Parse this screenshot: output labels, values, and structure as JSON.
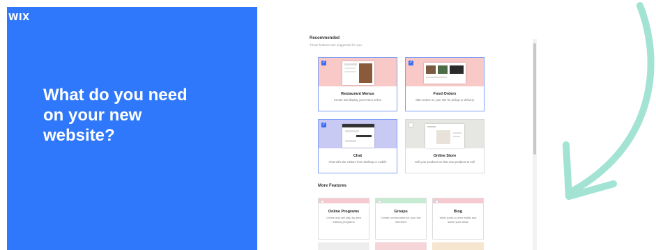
{
  "left": {
    "logo": "WIX",
    "headline": "What do you need on your new website?"
  },
  "recommended": {
    "title": "Recommended",
    "subtitle": "These features are suggested for you",
    "cards": [
      {
        "title": "Restaurant Menus",
        "desc": "Create and display your menu online",
        "selected": true,
        "color": "#f9c9c8"
      },
      {
        "title": "Food Orders",
        "desc": "Take orders on your site for pickup or delivery",
        "selected": true,
        "color": "#f9c9c8"
      },
      {
        "title": "Chat",
        "desc": "Chat with site visitors from desktop or mobile",
        "selected": true,
        "color": "#c9caf4"
      },
      {
        "title": "Online Store",
        "desc": "Sell your products on that new products to sell",
        "selected": false,
        "color": "#e6e6e2"
      }
    ]
  },
  "more": {
    "title": "More Features",
    "cards": [
      {
        "title": "Online Programs",
        "desc": "Create and sell step-by-step training programs",
        "color": "#f5c9cf"
      },
      {
        "title": "Groups",
        "desc": "Create communities for your site members",
        "color": "#c6ebd0"
      },
      {
        "title": "Blog",
        "desc": "Write posts to drive traffic and share your ideas",
        "color": "#f5c9cf"
      }
    ]
  },
  "colors": {
    "brand_blue": "#2f78fb",
    "arrow": "#a3e3d3",
    "check": "#3b6cf6"
  }
}
